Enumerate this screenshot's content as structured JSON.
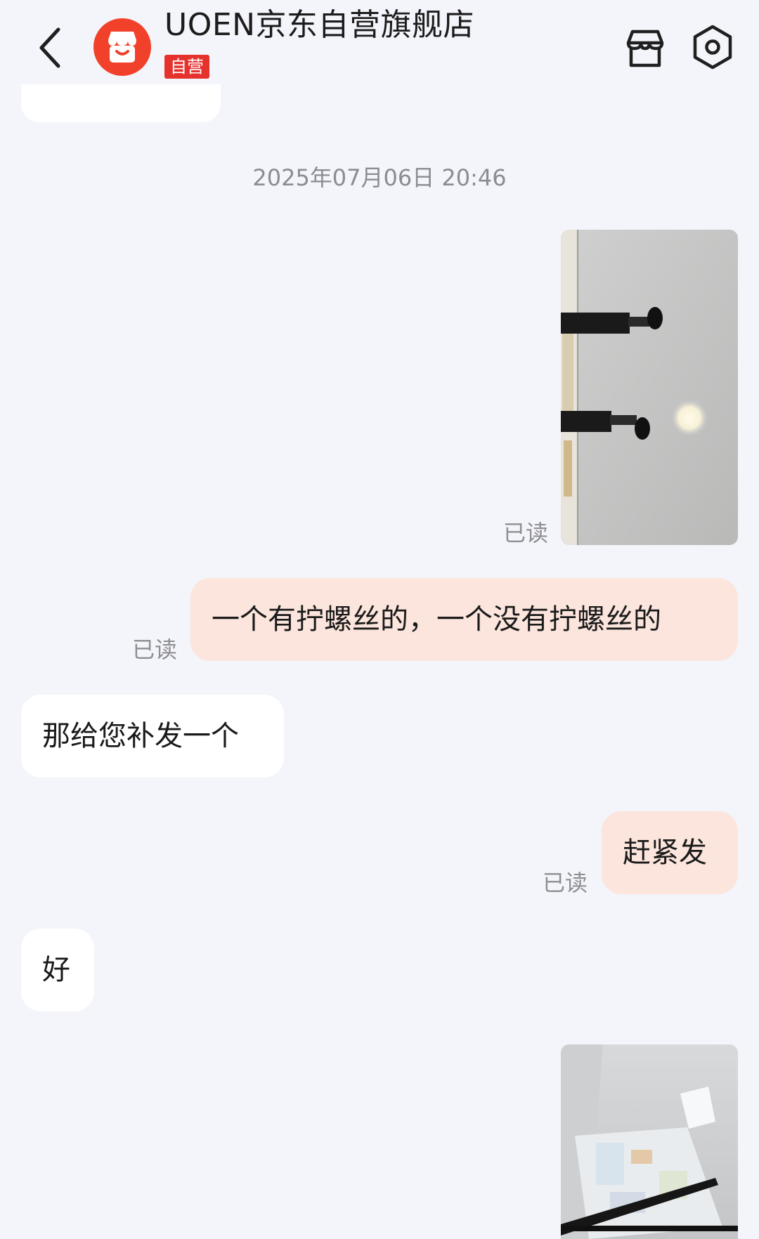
{
  "header": {
    "shop_name": "UOEN京东自营旗舰店",
    "badge": "自营",
    "icons": [
      "chevron-left-icon",
      "shop-avatar-icon",
      "store-icon",
      "settings-hex-icon"
    ]
  },
  "chat": {
    "timestamp": "2025年07月06日 20:46",
    "read_label": "已读",
    "messages": [
      {
        "from": "me",
        "type": "image",
        "description_icon": "photo-wall-hooks",
        "read": "已读"
      },
      {
        "from": "me",
        "type": "text",
        "text": "一个有拧螺丝的，一个没有拧螺丝的",
        "read": "已读"
      },
      {
        "from": "shop",
        "type": "text",
        "text": "那给您补发一个"
      },
      {
        "from": "me",
        "type": "text",
        "text": "赶紧发",
        "read": "已读"
      },
      {
        "from": "shop",
        "type": "text",
        "text": "好"
      },
      {
        "from": "me",
        "type": "image",
        "description_icon": "photo-rod-on-newspaper"
      }
    ]
  },
  "colors": {
    "background": "#f4f5fa",
    "my_bubble": "#fbe5dd",
    "their_bubble": "#ffffff",
    "brand_red": "#e5322d",
    "avatar_red": "#f2412b",
    "muted_text": "#8e8e93"
  }
}
